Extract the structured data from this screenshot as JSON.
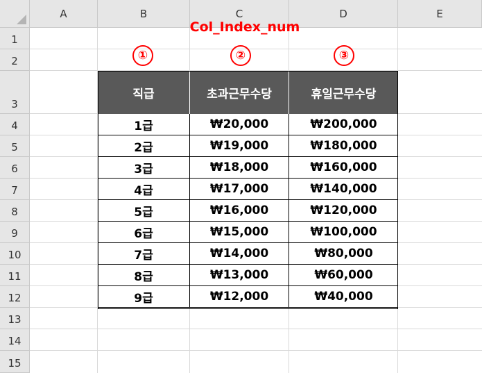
{
  "columns": [
    "A",
    "B",
    "C",
    "D",
    "E"
  ],
  "rows": [
    "1",
    "2",
    "3",
    "4",
    "5",
    "6",
    "7",
    "8",
    "9",
    "10",
    "11",
    "12",
    "13",
    "14",
    "15"
  ],
  "annotation": {
    "title": "Col_Index_num",
    "markers": [
      "①",
      "②",
      "③"
    ]
  },
  "table": {
    "headers": [
      "직급",
      "초과근무수당",
      "휴일근무수당"
    ],
    "data": [
      [
        "1급",
        "₩20,000",
        "₩200,000"
      ],
      [
        "2급",
        "₩19,000",
        "₩180,000"
      ],
      [
        "3급",
        "₩18,000",
        "₩160,000"
      ],
      [
        "4급",
        "₩17,000",
        "₩140,000"
      ],
      [
        "5급",
        "₩16,000",
        "₩120,000"
      ],
      [
        "6급",
        "₩15,000",
        "₩100,000"
      ],
      [
        "7급",
        "₩14,000",
        "₩80,000"
      ],
      [
        "8급",
        "₩13,000",
        "₩60,000"
      ],
      [
        "9급",
        "₩12,000",
        "₩40,000"
      ]
    ]
  },
  "colors": {
    "header_bg": "#595959",
    "header_text": "#ffffff",
    "annotation": "#ff0000"
  }
}
